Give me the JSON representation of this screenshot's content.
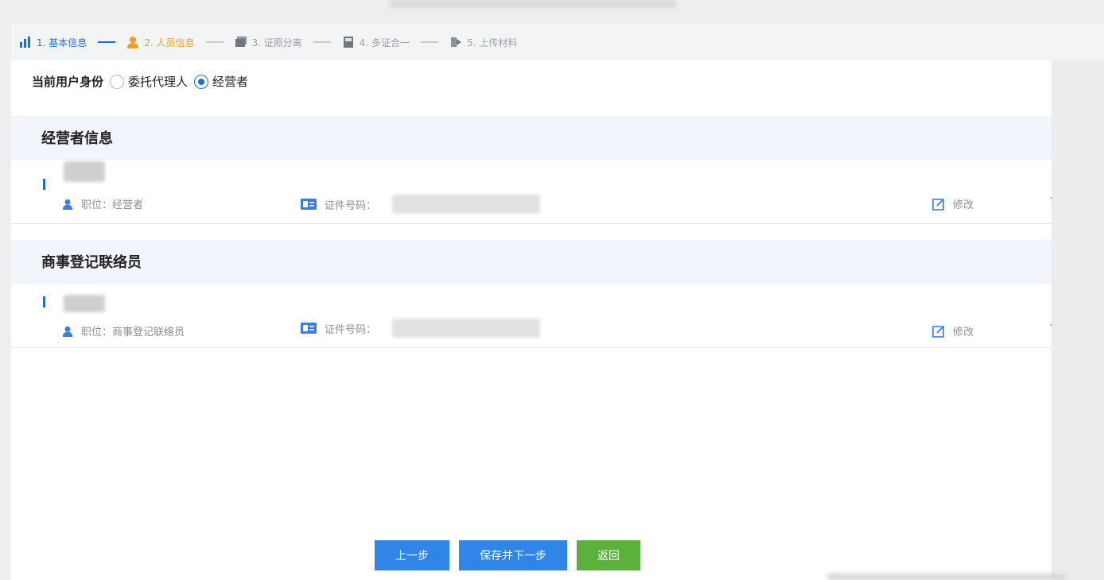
{
  "steps": [
    {
      "label": "1. 基本信息",
      "state": "done",
      "icon": "chart-icon"
    },
    {
      "label": "2. 人员信息",
      "state": "active",
      "icon": "person-icon"
    },
    {
      "label": "3. 证照分离",
      "state": "todo",
      "icon": "certificate-icon"
    },
    {
      "label": "4. 多证合一",
      "state": "todo",
      "icon": "book-icon"
    },
    {
      "label": "5. 上传材料",
      "state": "todo",
      "icon": "upload-icon"
    }
  ],
  "identity": {
    "label": "当前用户身份",
    "options": [
      "委托代理人",
      "经营者"
    ],
    "selected": "经营者"
  },
  "sections": [
    {
      "title": "经营者信息",
      "role_label": "职位：经营者",
      "id_label": "证件号码：",
      "edit_label": "修改",
      "delete_label": "删除"
    },
    {
      "title": "商事登记联络员",
      "role_label": "职位：商事登记联络员",
      "id_label": "证件号码：",
      "edit_label": "修改",
      "delete_label": "删除"
    }
  ],
  "buttons": {
    "prev": "上一步",
    "save_next": "保存并下一步",
    "back": "返回"
  },
  "colors": {
    "primary": "#1f6fd1",
    "active_step": "#f0a020",
    "button_blue": "#2f86e8",
    "button_green": "#5bb13c",
    "delete_red": "#e0393e"
  }
}
